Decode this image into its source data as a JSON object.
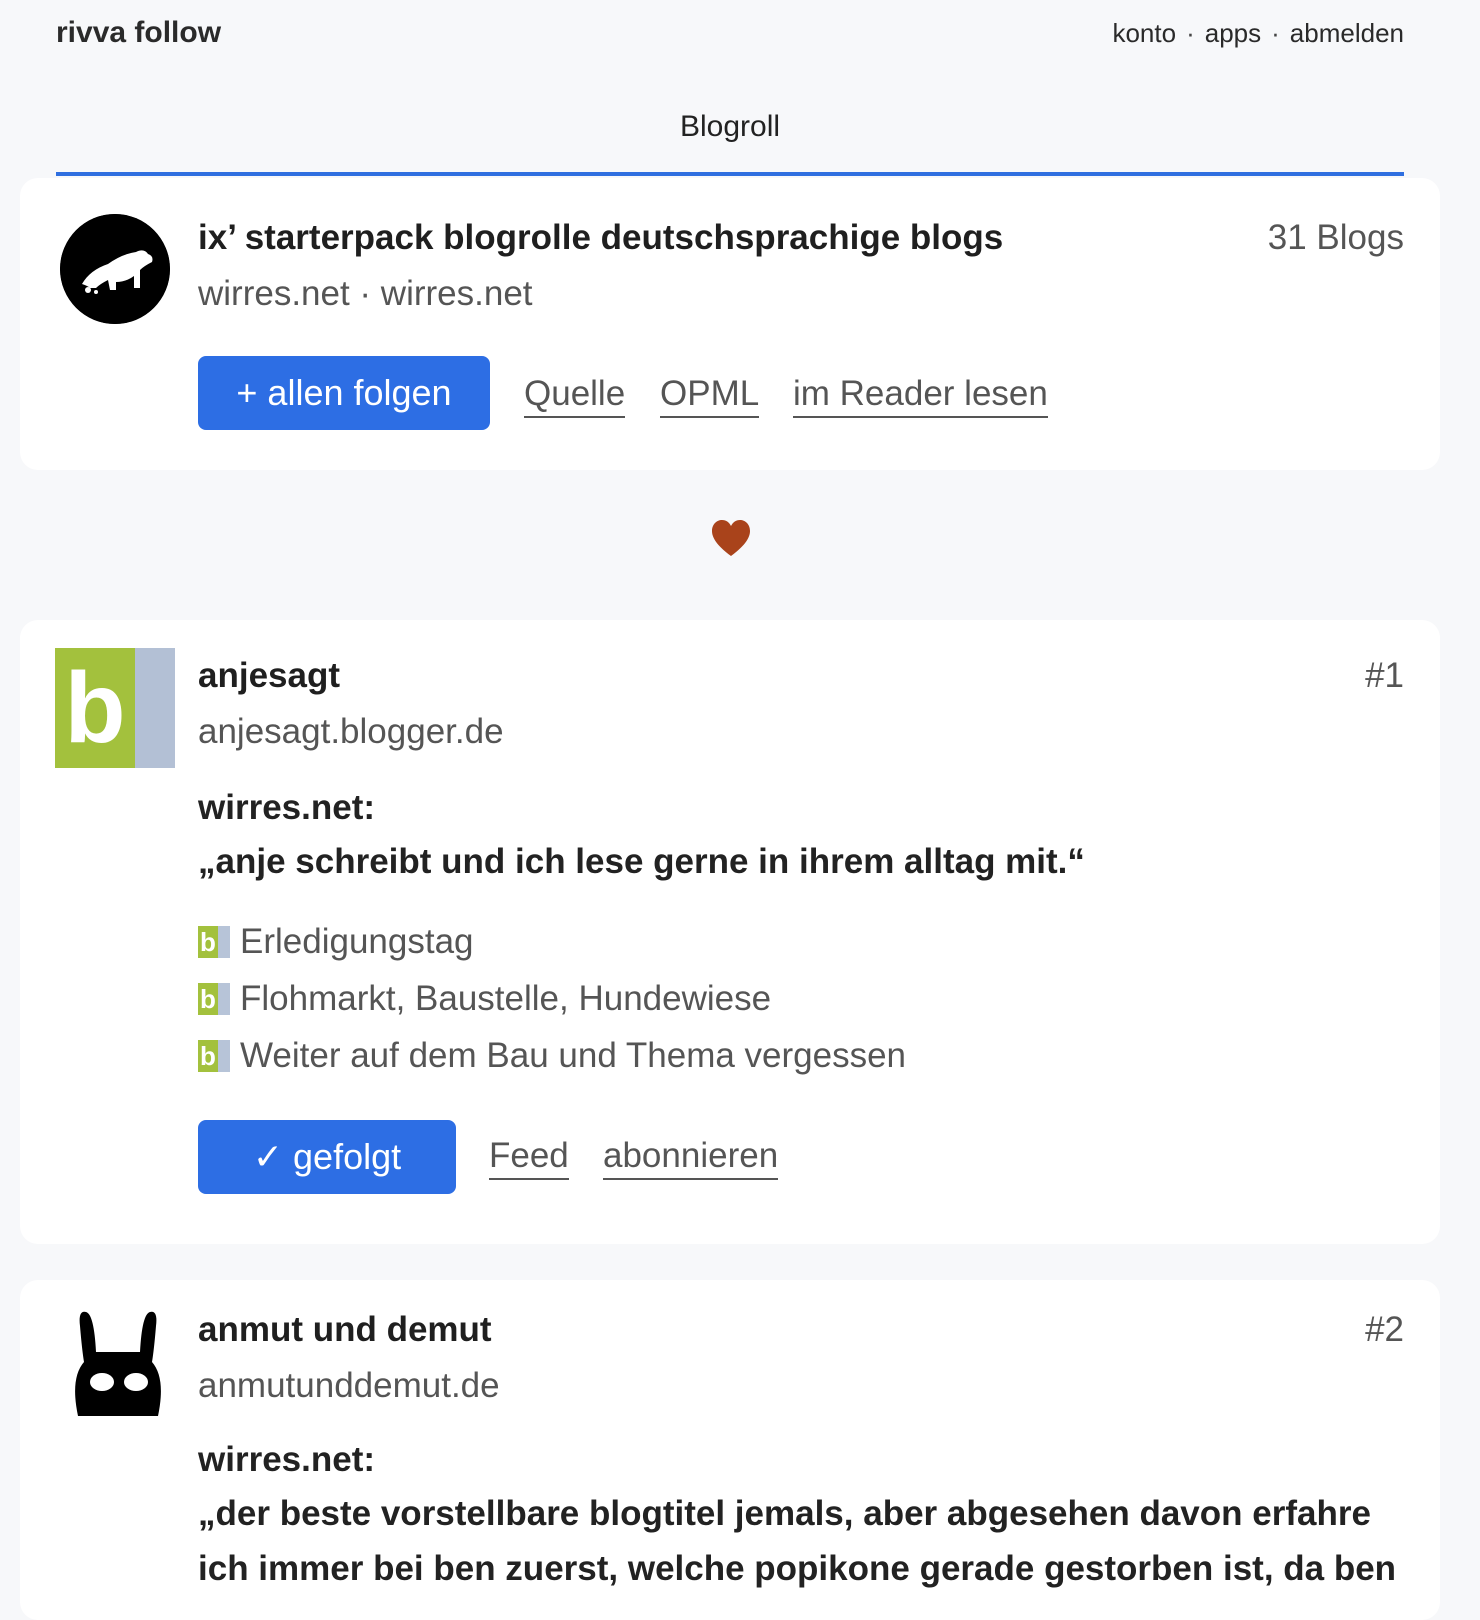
{
  "header": {
    "brand": "rivva follow",
    "nav": [
      {
        "label": "konto"
      },
      {
        "label": "apps"
      },
      {
        "label": "abmelden"
      }
    ],
    "separator": "·"
  },
  "tab": {
    "label": "Blogroll"
  },
  "blogroll": {
    "title": "ix’ starterpack blogrolle deutschsprachige blogs",
    "subtitle": "wirres.net · wirres.net",
    "count": "31 Blogs",
    "follow_all": "+ allen folgen",
    "links": {
      "source": "Quelle",
      "opml": "OPML",
      "reader": "im Reader lesen"
    },
    "avatar_icon": "dog-silhouette-icon"
  },
  "divider_icon": "heart-icon",
  "blogs": [
    {
      "rank": "#1",
      "name": "anjesagt",
      "domain": "anjesagt.blogger.de",
      "quote_source": "wirres.net:",
      "quote": "„anje schreibt und ich lese gerne in ihrem alltag mit.“",
      "logo_letter": "b",
      "posts": [
        {
          "title": "Erledigungstag"
        },
        {
          "title": "Flohmarkt, Baustelle, Hundewiese"
        },
        {
          "title": "Weiter auf dem Bau und Thema vergessen"
        }
      ],
      "followed_label": "✓ gefolgt",
      "feed_label": "Feed",
      "subscribe_label": "abonnieren"
    },
    {
      "rank": "#2",
      "name": "anmut und demut",
      "domain": "anmutunddemut.de",
      "quote_source": "wirres.net:",
      "quote": "„der beste vorstellbare blogtitel jemals, aber abgesehen davon erfahre ich immer bei ben zuerst, welche popikone gerade gestorben ist, da ben",
      "avatar_icon": "rabbit-head-icon"
    }
  ],
  "colors": {
    "accent": "#2d6ee4",
    "heart": "#a9431b",
    "blogger_green": "#a3c13d",
    "blogger_gray": "#b3c0d5",
    "background": "#f7f8fa"
  }
}
